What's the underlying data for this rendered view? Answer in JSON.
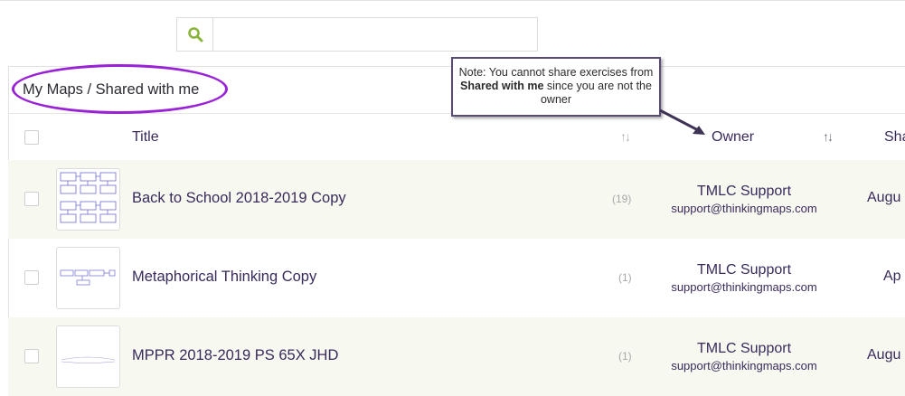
{
  "search": {
    "placeholder": "",
    "value": ""
  },
  "breadcrumb": "My Maps / Shared with me",
  "note": {
    "prefix": "Note: You cannot share exercises from ",
    "bold": "Shared with me",
    "suffix": " since you are not the owner"
  },
  "table": {
    "headers": {
      "title": "Title",
      "owner": "Owner",
      "shared": "Sha"
    },
    "rows": [
      {
        "title": "Back to School 2018-2019 Copy",
        "count": "(19)",
        "owner_name": "TMLC Support",
        "owner_email": "support@thinkingmaps.com",
        "date": "Augu"
      },
      {
        "title": "Metaphorical Thinking Copy",
        "count": "(1)",
        "owner_name": "TMLC Support",
        "owner_email": "support@thinkingmaps.com",
        "date": "Ap"
      },
      {
        "title": "MPPR 2018-2019 PS 65X JHD",
        "count": "(1)",
        "owner_name": "TMLC Support",
        "owner_email": "support@thinkingmaps.com",
        "date": "Augu"
      }
    ]
  },
  "colors": {
    "accent_search": "#8ab43c",
    "oval": "#9a22d6",
    "text": "#3a2a5c",
    "row_alt": "#f7f8f0"
  },
  "icons": {
    "search": "search-icon",
    "sort": "sort-icon"
  }
}
